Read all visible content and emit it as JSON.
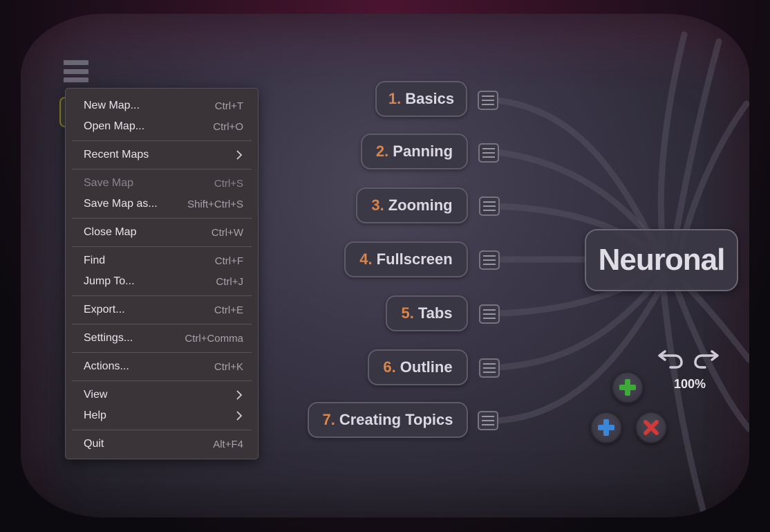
{
  "menu": {
    "items": [
      {
        "label": "New Map...",
        "shortcut": "Ctrl+T"
      },
      {
        "label": "Open Map...",
        "shortcut": "Ctrl+O"
      },
      {
        "label": "Recent Maps",
        "shortcut": ""
      },
      {
        "label": "Save Map",
        "shortcut": "Ctrl+S"
      },
      {
        "label": "Save Map as...",
        "shortcut": "Shift+Ctrl+S"
      },
      {
        "label": "Close Map",
        "shortcut": "Ctrl+W"
      },
      {
        "label": "Find",
        "shortcut": "Ctrl+F"
      },
      {
        "label": "Jump To...",
        "shortcut": "Ctrl+J"
      },
      {
        "label": "Export...",
        "shortcut": "Ctrl+E"
      },
      {
        "label": "Settings...",
        "shortcut": "Ctrl+Comma"
      },
      {
        "label": "Actions...",
        "shortcut": "Ctrl+K"
      },
      {
        "label": "View",
        "shortcut": ""
      },
      {
        "label": "Help",
        "shortcut": ""
      },
      {
        "label": "Quit",
        "shortcut": "Alt+F4"
      }
    ]
  },
  "map": {
    "root": "Neuronal",
    "topics": [
      {
        "num": "1.",
        "label": "Basics"
      },
      {
        "num": "2.",
        "label": "Panning"
      },
      {
        "num": "3.",
        "label": "Zooming"
      },
      {
        "num": "4.",
        "label": "Fullscreen"
      },
      {
        "num": "5.",
        "label": "Tabs"
      },
      {
        "num": "6.",
        "label": "Outline"
      },
      {
        "num": "7.",
        "label": "Creating Topics"
      }
    ]
  },
  "controls": {
    "zoom": "100%",
    "icons": [
      "undo-icon",
      "redo-icon",
      "add-child-icon",
      "add-sibling-icon",
      "delete-icon"
    ]
  },
  "colors": {
    "topic_number": "#d8844a",
    "add_green": "#3ea83a",
    "add_blue": "#3a86d8",
    "delete_red": "#d23a3a"
  }
}
